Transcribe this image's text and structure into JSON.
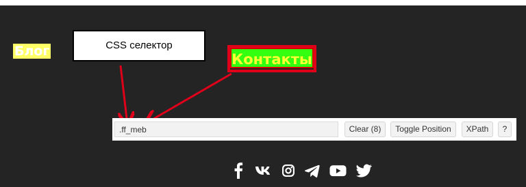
{
  "nav": {
    "blog_label": "Блог",
    "contacts_label": "Контакты"
  },
  "annotation": {
    "callout_label": "CSS селектор",
    "arrow_color": "#e0001a"
  },
  "selector_bar": {
    "input_value": ".ff_meb",
    "clear_label": "Clear (8)",
    "toggle_label": "Toggle Position",
    "xpath_label": "XPath",
    "help_label": "?"
  },
  "social": {
    "icons": [
      "facebook-icon",
      "vk-icon",
      "instagram-icon",
      "telegram-icon",
      "youtube-icon",
      "twitter-icon"
    ]
  },
  "colors": {
    "page_background": "#242424",
    "blog_highlight": "#ffff66",
    "contacts_highlight": "#33ff11",
    "contacts_text": "#ffff33",
    "highlight_border": "#e0001a"
  }
}
